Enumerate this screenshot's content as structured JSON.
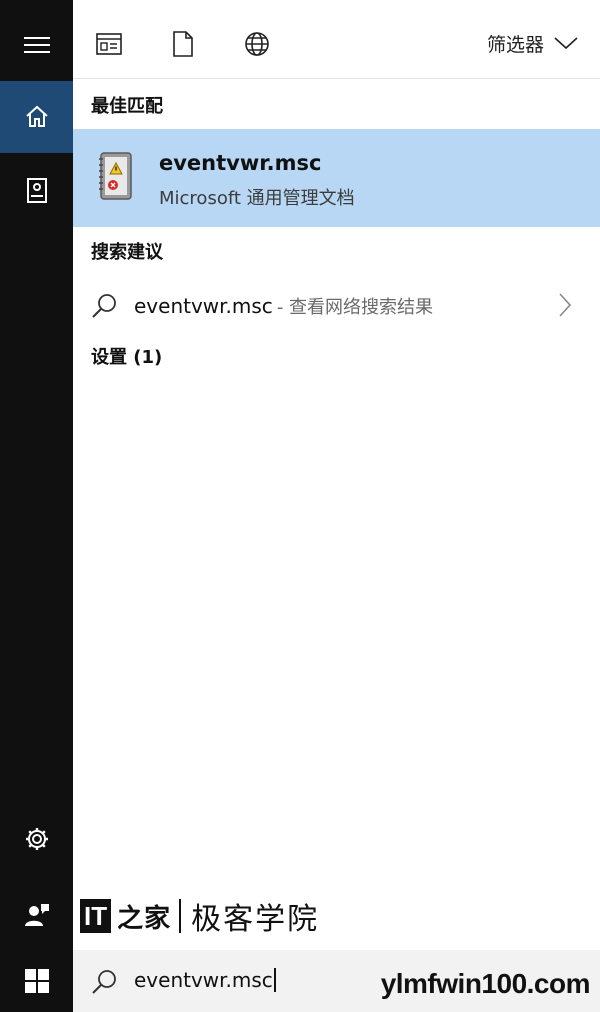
{
  "topbar": {
    "filter_label": "筛选器"
  },
  "sections": {
    "best_match": "最佳匹配",
    "suggestions": "搜索建议",
    "settings": "设置 (1)"
  },
  "best_match_item": {
    "name": "eventvwr.msc",
    "subtitle": "Microsoft 通用管理文档"
  },
  "suggestion": {
    "query": "eventvwr.msc",
    "hint": "- 查看网络搜索结果"
  },
  "search": {
    "value": "eventvwr.msc"
  },
  "watermark": {
    "logo": "IT",
    "brand": "之家",
    "name": "极客学院"
  },
  "site_mark": "ylmfwin100.com",
  "colors": {
    "rail_bg": "#101010",
    "rail_active": "#1f4a76",
    "selected_bg": "#b8d7f4",
    "search_bg": "#f2f2f2"
  }
}
